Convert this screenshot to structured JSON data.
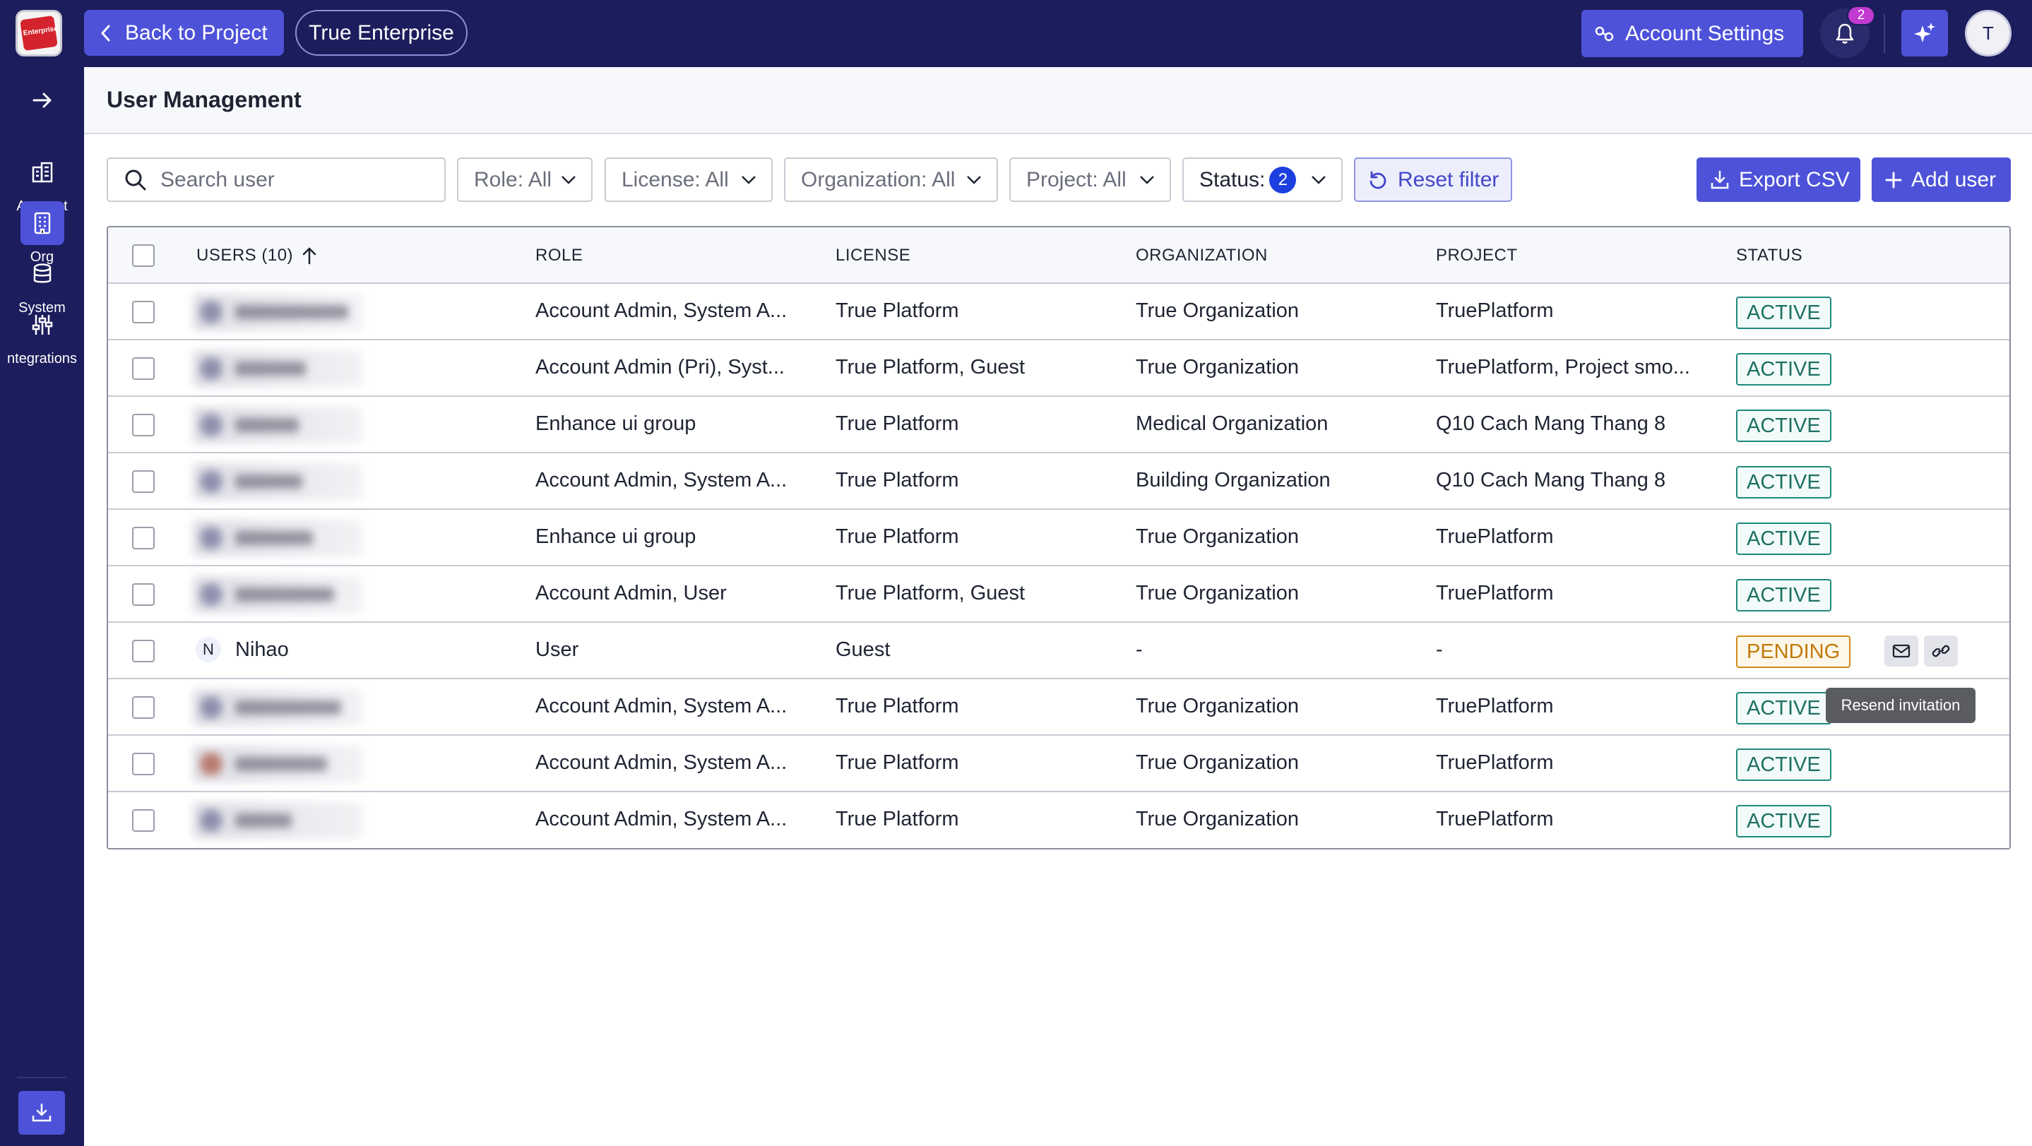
{
  "topbar": {
    "logo_text": "Enterprise",
    "back_label": "Back to Project",
    "project_name": "True Enterprise",
    "account_settings_label": "Account Settings",
    "notification_count": "2",
    "user_initial": "T"
  },
  "sidebar": {
    "items": [
      {
        "label": "Account",
        "icon": "building-icon",
        "active": false
      },
      {
        "label": "Org",
        "icon": "office-icon",
        "active": true
      },
      {
        "label": "System",
        "icon": "database-icon",
        "active": false
      },
      {
        "label": "ntegrations",
        "icon": "sliders-icon",
        "active": false
      }
    ]
  },
  "page": {
    "title": "User Management"
  },
  "filters": {
    "search_placeholder": "Search user",
    "role": "Role: All",
    "license": "License: All",
    "organization": "Organization: All",
    "project": "Project: All",
    "status_label": "Status:",
    "status_count": "2",
    "reset_label": "Reset filter",
    "export_label": "Export CSV",
    "add_user_label": "Add user"
  },
  "table": {
    "columns": [
      "USERS (10)",
      "ROLE",
      "LICENSE",
      "ORGANIZATION",
      "PROJECT",
      "STATUS"
    ],
    "rows": [
      {
        "name": "",
        "role": "Account Admin, System A...",
        "license": "True Platform",
        "organization": "True Organization",
        "project": "TruePlatform",
        "status": "ACTIVE"
      },
      {
        "name": "",
        "role": "Account Admin (Pri), Syst...",
        "license": "True Platform, Guest",
        "organization": "True Organization",
        "project": "TruePlatform, Project smo...",
        "status": "ACTIVE"
      },
      {
        "name": "",
        "role": "Enhance ui group",
        "license": "True Platform",
        "organization": "Medical Organization",
        "project": "Q10 Cach Mang Thang 8",
        "status": "ACTIVE"
      },
      {
        "name": "",
        "role": "Account Admin, System A...",
        "license": "True Platform",
        "organization": "Building Organization",
        "project": "Q10 Cach Mang Thang 8",
        "status": "ACTIVE"
      },
      {
        "name": "",
        "role": "Enhance ui group",
        "license": "True Platform",
        "organization": "True Organization",
        "project": "TruePlatform",
        "status": "ACTIVE"
      },
      {
        "name": "",
        "role": "Account Admin, User",
        "license": "True Platform, Guest",
        "organization": "True Organization",
        "project": "TruePlatform",
        "status": "ACTIVE"
      },
      {
        "name": "Nihao",
        "initial": "N",
        "role": "User",
        "license": "Guest",
        "organization": "-",
        "project": "-",
        "status": "PENDING"
      },
      {
        "name": "",
        "role": "Account Admin, System A...",
        "license": "True Platform",
        "organization": "True Organization",
        "project": "TruePlatform",
        "status": "ACTIVE"
      },
      {
        "name": "",
        "role": "Account Admin, System A...",
        "license": "True Platform",
        "organization": "True Organization",
        "project": "TruePlatform",
        "status": "ACTIVE"
      },
      {
        "name": "",
        "role": "Account Admin, System A...",
        "license": "True Platform",
        "organization": "True Organization",
        "project": "TruePlatform",
        "status": "ACTIVE"
      }
    ]
  },
  "tooltip": {
    "text": "Resend invitation"
  },
  "colors": {
    "nav_bg": "#1c1d5c",
    "accent": "#4d52d9",
    "active_status": "#1d8a7c",
    "pending_status": "#d28a18"
  }
}
